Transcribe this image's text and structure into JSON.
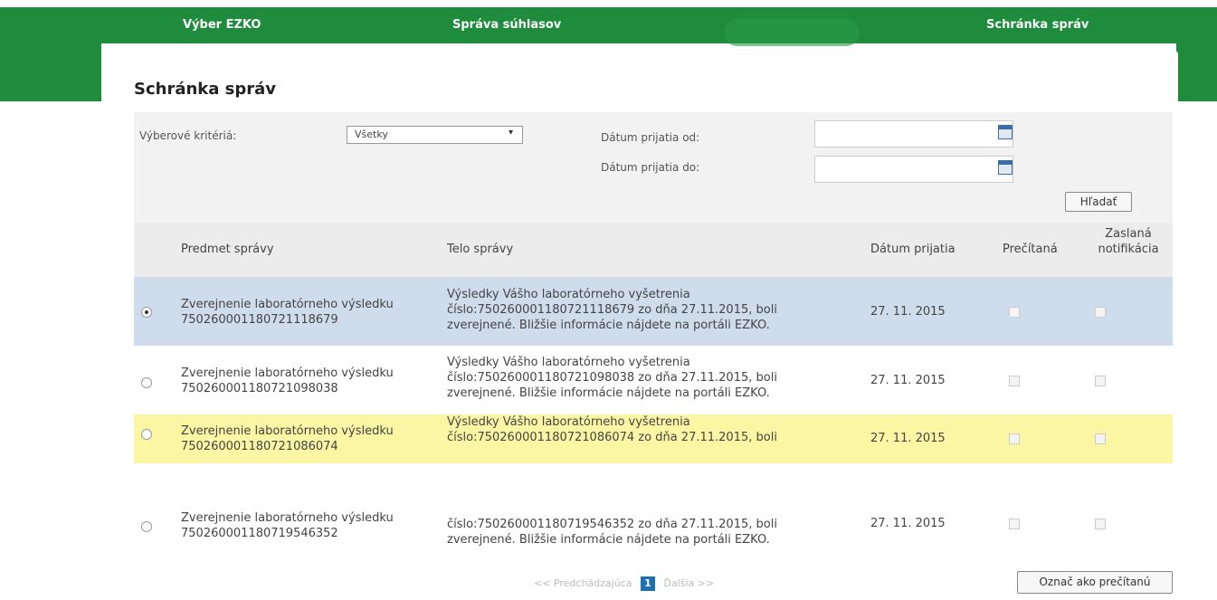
{
  "nav": {
    "items": [
      "Výber EZKO",
      "Správa súhlasov",
      "Schránka správ"
    ]
  },
  "page_title": "Schránka správ",
  "filter": {
    "criteria_label": "Výberové kritériá:",
    "criteria_value": "Všetky",
    "date_from_label": "Dátum prijatia od:",
    "date_to_label": "Dátum prijatia do:",
    "date_from_value": "",
    "date_to_value": "",
    "search_label": "Hľadať"
  },
  "table": {
    "columns": [
      "Predmet správy",
      "Telo správy",
      "Dátum prijatia",
      "Prečítaná",
      "Zaslaná notifikácia"
    ],
    "rows": [
      {
        "subject": [
          "Zverejnenie laboratórneho výsledku",
          "750260001180721118679"
        ],
        "body": [
          "Výsledky Vášho laboratórneho vyšetrenia",
          "číslo:750260001180721118679 zo dňa 27.11.2015, boli",
          "zverejnené. Bližšie informácie nájdete na portáli EZKO."
        ],
        "date": "27. 11. 2015",
        "selected": true
      },
      {
        "subject": [
          "Zverejnenie laboratórneho výsledku",
          "750260001180721098038"
        ],
        "body": [
          "Výsledky Vášho laboratórneho vyšetrenia",
          "číslo:750260001180721098038 zo dňa 27.11.2015, boli",
          "zverejnené. Bližšie informácie nájdete na portáli EZKO."
        ],
        "date": "27. 11. 2015",
        "selected": false
      },
      {
        "subject": [
          "Zverejnenie laboratórneho výsledku",
          "750260001180721086074"
        ],
        "body": [
          "Výsledky Vášho laboratórneho vyšetrenia",
          "číslo:750260001180721086074 zo dňa 27.11.2015, boli",
          ""
        ],
        "date": "27. 11. 2015",
        "selected": false
      },
      {
        "subject": [
          "Zverejnenie laboratórneho výsledku",
          "750260001180719546352"
        ],
        "body": [
          "",
          "číslo:750260001180719546352 zo dňa 27.11.2015, boli",
          "zverejnené. Bližšie informácie nájdete na portáli EZKO."
        ],
        "date": "27. 11. 2015",
        "selected": false
      }
    ]
  },
  "pager": {
    "prev_label": "<< Predchádzajúca",
    "current_page": "1",
    "next_label": "Ďalšia >>"
  },
  "mark_read_label": "Označ ako prečítanú",
  "colors": {
    "brand": "#1e8c3c",
    "selected_row": "#cfdcec",
    "highlight_row": "#fbf6a3"
  }
}
